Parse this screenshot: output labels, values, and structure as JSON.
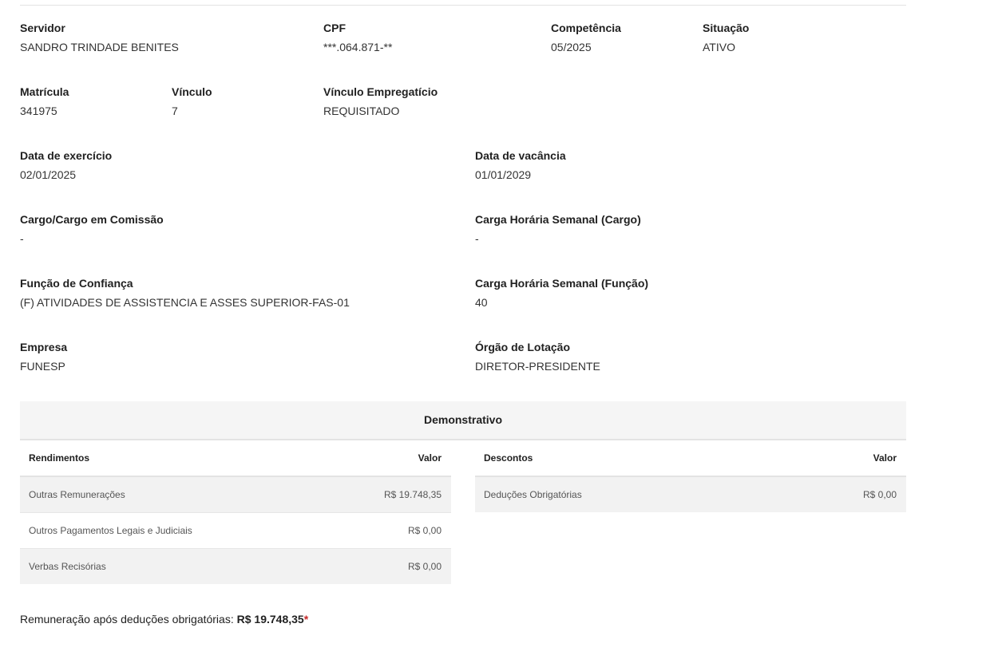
{
  "fields": {
    "servidor": {
      "label": "Servidor",
      "value": "SANDRO TRINDADE BENITES"
    },
    "cpf": {
      "label": "CPF",
      "value": "***.064.871-**"
    },
    "competencia": {
      "label": "Competência",
      "value": "05/2025"
    },
    "situacao": {
      "label": "Situação",
      "value": "ATIVO"
    },
    "matricula": {
      "label": "Matrícula",
      "value": "341975"
    },
    "vinculo": {
      "label": "Vínculo",
      "value": "7"
    },
    "vinculo_empregaticio": {
      "label": "Vínculo Empregatício",
      "value": "REQUISITADO"
    },
    "data_exercicio": {
      "label": "Data de exercício",
      "value": "02/01/2025"
    },
    "data_vacancia": {
      "label": "Data de vacância",
      "value": "01/01/2029"
    },
    "cargo": {
      "label": "Cargo/Cargo em Comissão",
      "value": "-"
    },
    "carga_cargo": {
      "label": "Carga Horária Semanal (Cargo)",
      "value": "-"
    },
    "funcao": {
      "label": "Função de Confiança",
      "value": "(F) ATIVIDADES DE ASSISTENCIA E ASSES SUPERIOR-FAS-01"
    },
    "carga_funcao": {
      "label": "Carga Horária Semanal (Função)",
      "value": "40"
    },
    "empresa": {
      "label": "Empresa",
      "value": "FUNESP"
    },
    "orgao": {
      "label": "Órgão de Lotação",
      "value": "DIRETOR-PRESIDENTE"
    }
  },
  "demonstrativo": {
    "title": "Demonstrativo",
    "rendimentos": {
      "header": "Rendimentos",
      "value_header": "Valor",
      "rows": [
        {
          "label": "Outras Remunerações",
          "value": "R$ 19.748,35"
        },
        {
          "label": "Outros Pagamentos Legais e Judiciais",
          "value": "R$ 0,00"
        },
        {
          "label": "Verbas Recisórias",
          "value": "R$ 0,00"
        }
      ]
    },
    "descontos": {
      "header": "Descontos",
      "value_header": "Valor",
      "rows": [
        {
          "label": "Deduções Obrigatórias",
          "value": "R$ 0,00"
        }
      ]
    }
  },
  "summary": {
    "label": "Remuneração após deduções obrigatórias: ",
    "amount": "R$ 19.748,35",
    "asterisk": "*"
  }
}
